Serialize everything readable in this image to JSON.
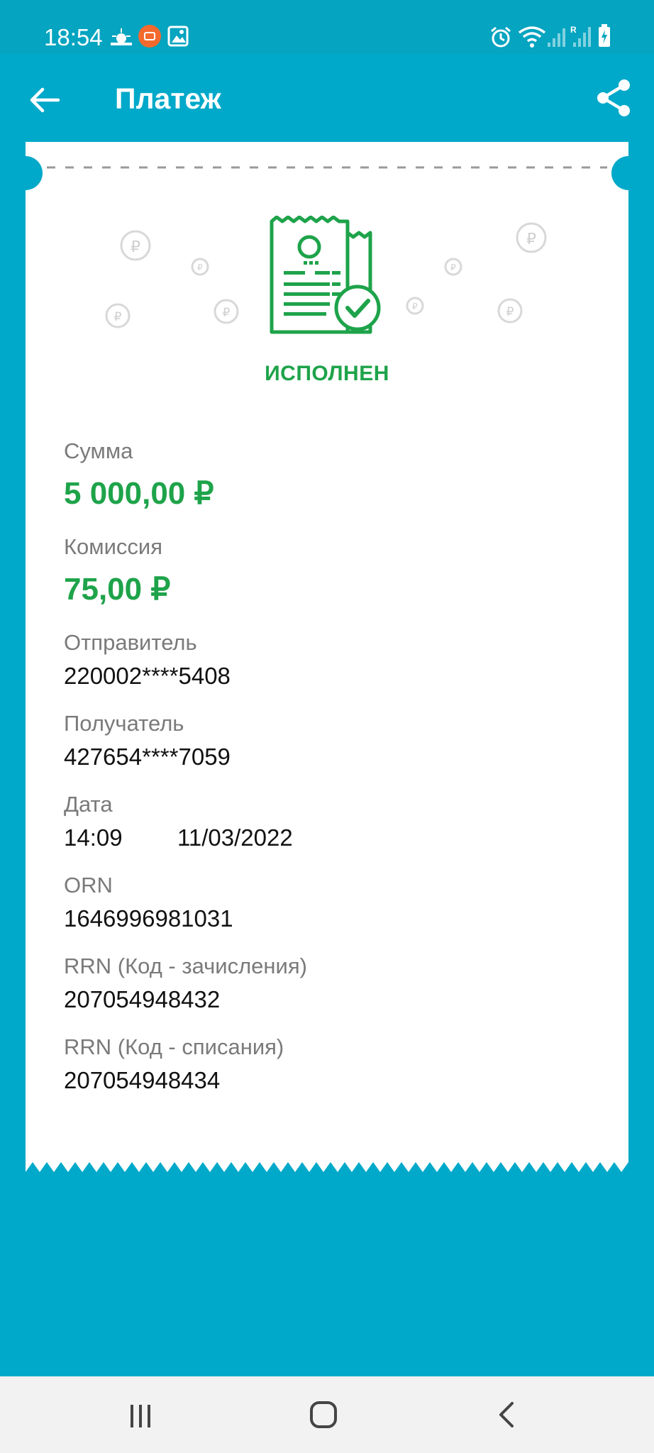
{
  "status_bar": {
    "time": "18:54"
  },
  "app_bar": {
    "title": "Платеж"
  },
  "receipt": {
    "status": "ИСПОЛНЕН",
    "fields": [
      {
        "label": "Сумма",
        "value": "5 000,00 ₽"
      },
      {
        "label": "Комиссия",
        "value": "75,00 ₽"
      },
      {
        "label": "Отправитель",
        "value": "220002****5408"
      },
      {
        "label": "Получатель",
        "value": "427654****7059"
      },
      {
        "label": "Дата",
        "time": "14:09",
        "date": "11/03/2022"
      },
      {
        "label": "ORN",
        "value": "1646996981031"
      },
      {
        "label": "RRN (Код - зачисления)",
        "value": "207054948432"
      },
      {
        "label": "RRN (Код - списания)",
        "value": "207054948434"
      }
    ]
  },
  "colors": {
    "background": "#00a9c9",
    "status_bar": "#05a4c0",
    "accent_green": "#1ea34a",
    "label_gray": "#7a7a7a",
    "nav_bar": "#f2f2f2"
  },
  "icons": {
    "back": "arrow-left-icon",
    "share": "share-icon",
    "receipt": "receipt-check-icon",
    "ruble_coin": "ruble-coin-icon",
    "nav_recent": "recent-apps-icon",
    "nav_home": "home-icon",
    "nav_back": "nav-back-icon"
  }
}
